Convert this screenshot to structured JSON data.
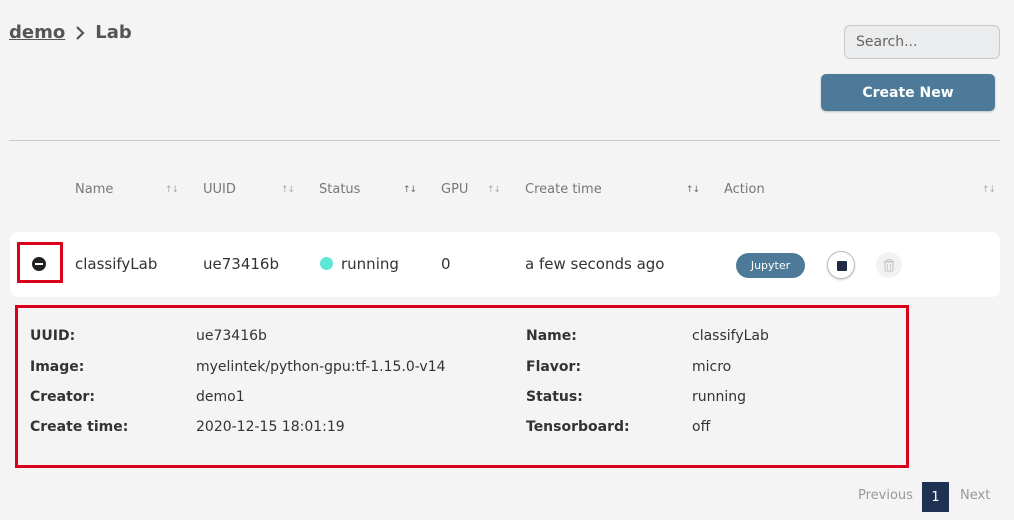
{
  "breadcrumb": {
    "parent": "demo",
    "current": "Lab"
  },
  "search": {
    "placeholder": "Search..."
  },
  "toolbar": {
    "create_label": "Create New"
  },
  "table": {
    "columns": [
      "Name",
      "UUID",
      "Status",
      "GPU",
      "Create time",
      "Action"
    ],
    "rows": [
      {
        "name": "classifyLab",
        "uuid": "ue73416b",
        "status": "running",
        "gpu": "0",
        "create_time": "a few seconds ago",
        "jupyter_label": "Jupyter"
      }
    ]
  },
  "detail": {
    "left": [
      {
        "label": "UUID:",
        "value": "ue73416b"
      },
      {
        "label": "Image:",
        "value": "myelintek/python-gpu:tf-1.15.0-v14"
      },
      {
        "label": "Creator:",
        "value": "demo1"
      },
      {
        "label": "Create time:",
        "value": "2020-12-15 18:01:19"
      }
    ],
    "right": [
      {
        "label": "Name:",
        "value": "classifyLab"
      },
      {
        "label": "Flavor:",
        "value": "micro"
      },
      {
        "label": "Status:",
        "value": "running"
      },
      {
        "label": "Tensorboard:",
        "value": "off"
      }
    ]
  },
  "pagination": {
    "previous": "Previous",
    "current": "1",
    "next": "Next"
  },
  "colors": {
    "accent": "#4e7a9a",
    "highlight": "#d9001b",
    "running": "#5ee6d6",
    "page_active": "#1f3254"
  }
}
